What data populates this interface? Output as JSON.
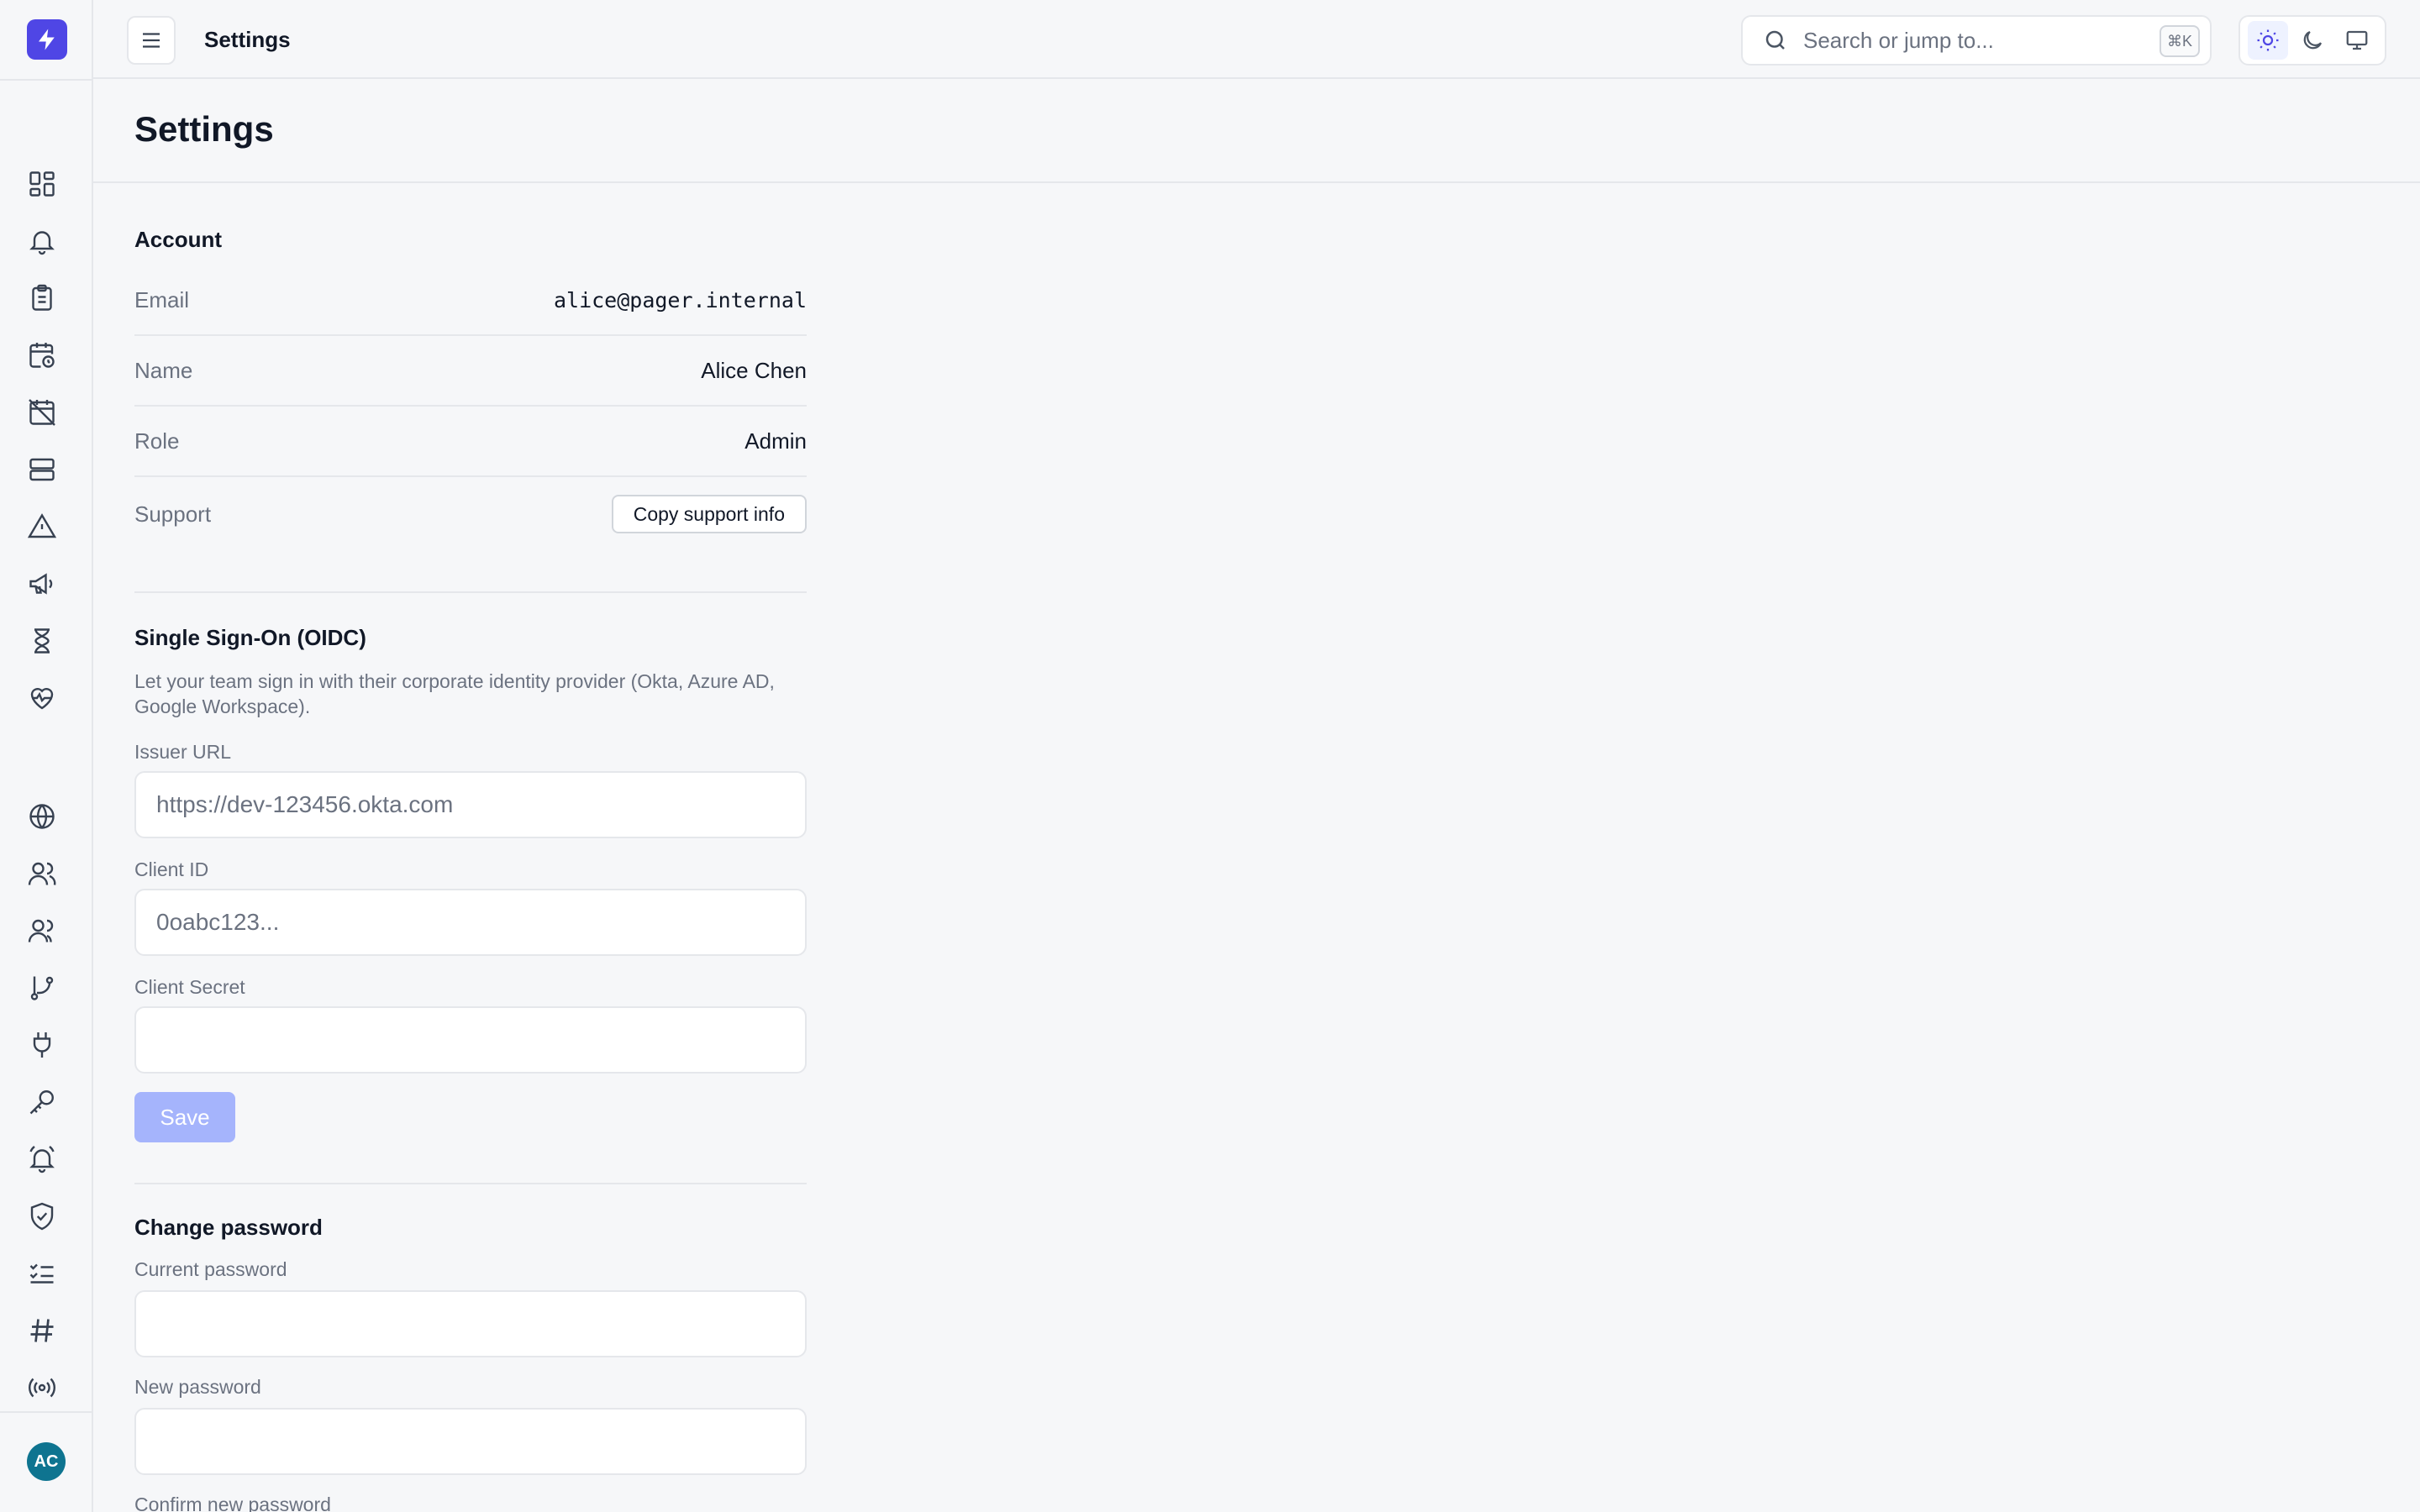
{
  "topbar": {
    "title": "Settings",
    "search_placeholder": "Search or jump to...",
    "search_shortcut": "⌘K"
  },
  "page": {
    "title": "Settings"
  },
  "sidebar": {
    "avatar_initials": "AC"
  },
  "account": {
    "title": "Account",
    "email_label": "Email",
    "email_value": "alice@pager.internal",
    "name_label": "Name",
    "name_value": "Alice Chen",
    "role_label": "Role",
    "role_value": "Admin",
    "support_label": "Support",
    "support_button": "Copy support info"
  },
  "sso": {
    "title": "Single Sign-On (OIDC)",
    "description": "Let your team sign in with their corporate identity provider (Okta, Azure AD, Google Workspace).",
    "issuer_label": "Issuer URL",
    "issuer_placeholder": "https://dev-123456.okta.com",
    "client_id_label": "Client ID",
    "client_id_placeholder": "0oabc123...",
    "client_secret_label": "Client Secret",
    "save_label": "Save"
  },
  "password": {
    "title": "Change password",
    "current_label": "Current password",
    "new_label": "New password",
    "confirm_label": "Confirm new password"
  },
  "colors": {
    "accent": "#4f46e5",
    "save_disabled": "#a5b4fc",
    "avatar": "#0e7490"
  }
}
